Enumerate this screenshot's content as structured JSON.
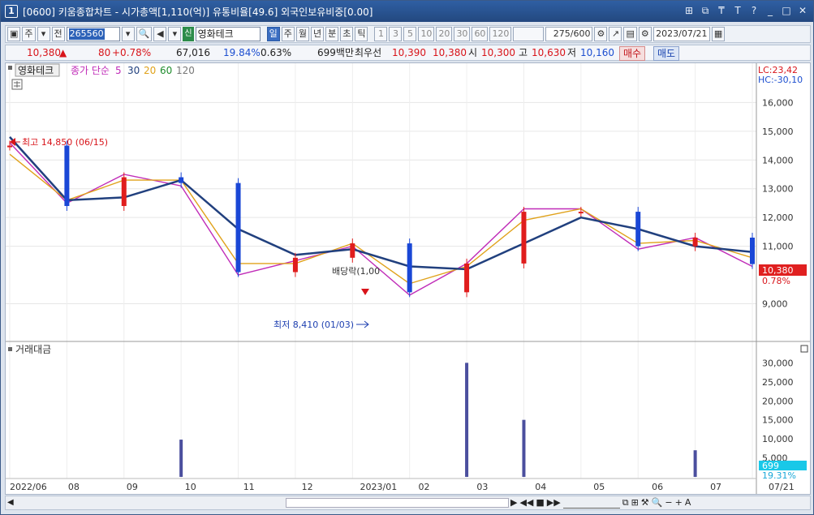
{
  "window": {
    "number": "1",
    "title": "[0600] 키움종합차트 - 시가총액[1,110(억)] 유통비율[49.6] 외국인보유비중[0.00]",
    "controls": [
      "⊞",
      "⧉",
      "₸",
      "T",
      "?",
      "_",
      "□",
      "✕"
    ]
  },
  "toolbar": {
    "market": "주",
    "prev_label": "전",
    "stock_code": "265560",
    "sin_badge": "신",
    "stock_name": "영화테크",
    "periods": [
      "일",
      "주",
      "월",
      "년",
      "분",
      "초",
      "틱"
    ],
    "active_period": "일",
    "intervals": [
      "1",
      "3",
      "5",
      "10",
      "20",
      "30",
      "60",
      "120"
    ],
    "count": "275",
    "count_max": "/600",
    "date": "2023/07/21"
  },
  "infobar": {
    "price": "10,380",
    "change": "80",
    "change_pct": "+0.78%",
    "volume": "67,016",
    "ratio1": "19.84%",
    "ratio2": "0.63%",
    "amount": "699백만",
    "best_label": "최우선",
    "best_ask": "10,390",
    "best_bid": "10,380",
    "open_label": "시",
    "open": "10,300",
    "high_label": "고",
    "high": "10,630",
    "low_label": "저",
    "low": "10,160",
    "buy_label": "매수",
    "sell_label": "매도"
  },
  "chart_data": {
    "type": "line",
    "title": "영화테크",
    "legend": [
      "종가 단순",
      "5",
      "30",
      "20",
      "60",
      "120"
    ],
    "y_ticks": [
      "16,000",
      "15,000",
      "14,000",
      "13,000",
      "12,000",
      "11,000",
      "9,000"
    ],
    "ylim": [
      8000,
      16800
    ],
    "x_ticks": [
      "2022/06",
      "08",
      "09",
      "10",
      "11",
      "12",
      "2023/01",
      "02",
      "03",
      "04",
      "05",
      "06",
      "07",
      "07/21"
    ],
    "lc_label": "LC:23,42",
    "hc_label": "HC:-30,10",
    "high_annotation": "최고 14,850 (06/15)",
    "low_annotation": "최저 8,410 (01/03)",
    "ex_dividend_label": "배당락(1,00",
    "current_price": "10,380",
    "current_pct": "0.78%",
    "series": [
      {
        "name": "종가 단순",
        "x": [
          "2022/06",
          "2022/07",
          "2022/08",
          "2022/09",
          "2022/10",
          "2022/11",
          "2022/12",
          "2023/01",
          "2023/02",
          "2023/03",
          "2023/04",
          "2023/05",
          "2023/06",
          "2023/07"
        ],
        "values": [
          14500,
          12400,
          13400,
          13200,
          10100,
          10600,
          11100,
          9400,
          10400,
          12200,
          12200,
          11000,
          11300,
          10380
        ]
      },
      {
        "name": "5",
        "values": [
          14600,
          12500,
          13500,
          13100,
          10000,
          10500,
          11000,
          9300,
          10400,
          12300,
          12300,
          10900,
          11300,
          10300
        ]
      },
      {
        "name": "20",
        "values": [
          14200,
          12600,
          13300,
          13300,
          10400,
          10400,
          11100,
          9700,
          10300,
          11900,
          12300,
          11100,
          11200,
          10600
        ]
      },
      {
        "name": "60",
        "values": [
          14800,
          12600,
          12700,
          13300,
          11600,
          10700,
          10900,
          10300,
          10200,
          11100,
          12000,
          11600,
          11000,
          10800
        ]
      }
    ],
    "volume_panel": {
      "title": "거래대금",
      "y_ticks": [
        "30,000",
        "25,000",
        "20,000",
        "15,000",
        "10,000",
        "5,000"
      ],
      "current": "699",
      "current_pct": "19.31%",
      "peaks": [
        {
          "x": "2022/09",
          "value": 9800
        },
        {
          "x": "2023/02",
          "value": 30000
        },
        {
          "x": "2023/03",
          "value": 15000
        },
        {
          "x": "2023/06",
          "value": 7000
        }
      ]
    }
  },
  "colors": {
    "candle_up": "#e01d1d",
    "candle_down": "#1a47d6",
    "ma_5": "#c02cb8",
    "ma_20": "#e0a21b",
    "ma_60": "#21407e",
    "ma_120": "#1e8c2c",
    "ma_long": "#888888"
  }
}
